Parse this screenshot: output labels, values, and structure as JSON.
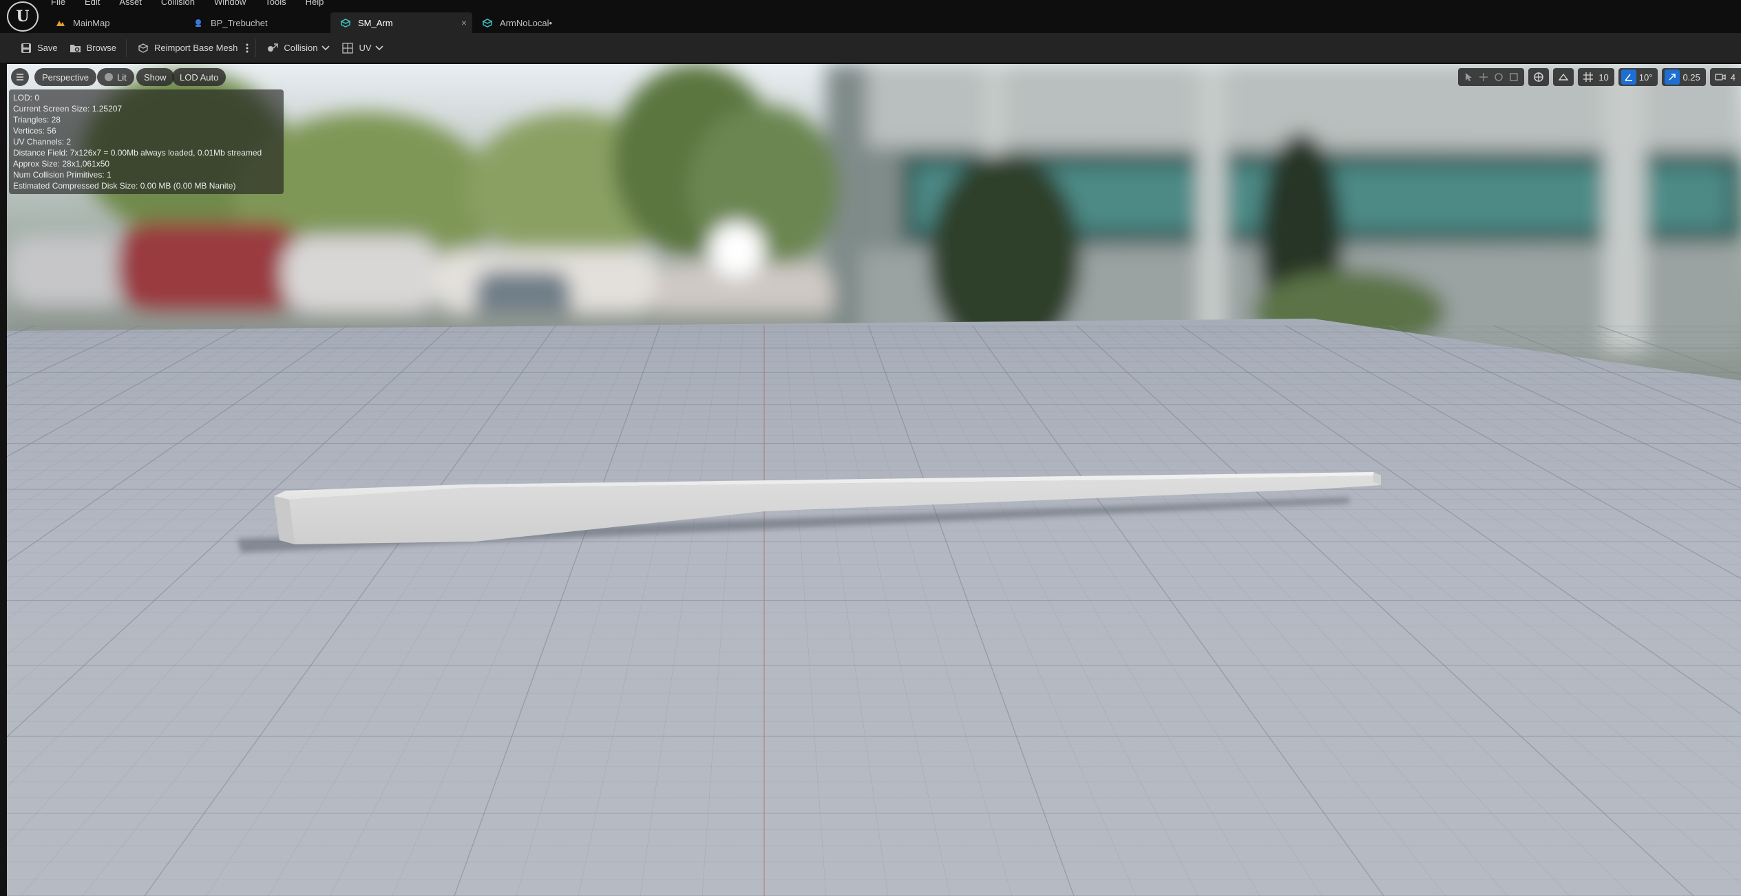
{
  "menu": [
    "File",
    "Edit",
    "Asset",
    "Collision",
    "Window",
    "Tools",
    "Help"
  ],
  "tabs": [
    {
      "label": "MainMap",
      "icon": "map-icon"
    },
    {
      "label": "BP_Trebuchet",
      "icon": "blueprint-icon"
    },
    {
      "label": "SM_Arm",
      "icon": "static-mesh-icon",
      "active": true,
      "close": "×"
    },
    {
      "label": "ArmNoLocal•",
      "icon": "static-mesh-icon"
    }
  ],
  "toolbar": {
    "save": "Save",
    "browse": "Browse",
    "reimport": "Reimport Base Mesh",
    "collision": "Collision",
    "uv": "UV"
  },
  "viewport": {
    "perspective": "Perspective",
    "lit": "Lit",
    "show": "Show",
    "lod": "LOD Auto",
    "grid_size": "10",
    "rotation_snap": "10°",
    "scale_snap": "0.25",
    "camera_speed": "4"
  },
  "stats": [
    "LOD:  0",
    "Current Screen Size:  1.25207",
    "Triangles:  28",
    "Vertices:  56",
    "UV Channels:  2",
    "Distance Field:  7x126x7 = 0.00Mb always loaded, 0.01Mb streamed",
    "Approx Size: 28x1,061x50",
    "Num Collision Primitives:  1",
    "Estimated Compressed Disk Size: 0.00 MB (0.00 MB Nanite)"
  ],
  "colors": {
    "accent_blue": "#1d6fd1",
    "mesh_tab_icon": "#3fc3c3",
    "map_tab_icon": "#e0a030",
    "blueprint_tab_icon": "#3a78d8"
  }
}
